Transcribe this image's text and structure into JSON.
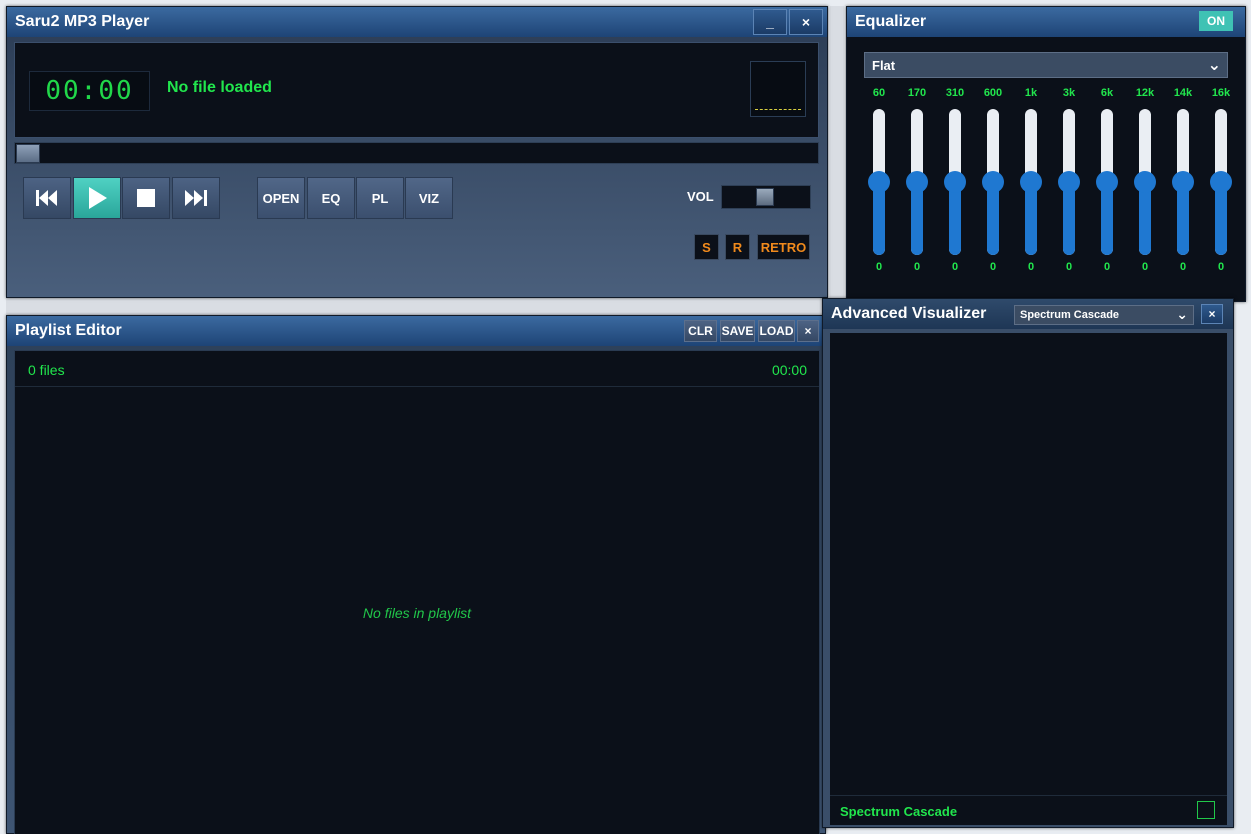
{
  "player": {
    "title": "Saru2 MP3 Player",
    "minimize_label": "_",
    "close_label": "×",
    "time": "00:00",
    "status": "No file loaded",
    "buttons": {
      "open": "OPEN",
      "eq": "EQ",
      "pl": "PL",
      "viz": "VIZ"
    },
    "volume_label": "VOL",
    "volume_level": 0.45,
    "options": {
      "shuffle": "S",
      "repeat": "R",
      "retro": "RETRO"
    }
  },
  "equalizer": {
    "title": "Equalizer",
    "toggle": "ON",
    "preset": "Flat",
    "bands": [
      {
        "freq": "60",
        "value": "0"
      },
      {
        "freq": "170",
        "value": "0"
      },
      {
        "freq": "310",
        "value": "0"
      },
      {
        "freq": "600",
        "value": "0"
      },
      {
        "freq": "1k",
        "value": "0"
      },
      {
        "freq": "3k",
        "value": "0"
      },
      {
        "freq": "6k",
        "value": "0"
      },
      {
        "freq": "12k",
        "value": "0"
      },
      {
        "freq": "14k",
        "value": "0"
      },
      {
        "freq": "16k",
        "value": "0"
      }
    ]
  },
  "playlist": {
    "title": "Playlist Editor",
    "buttons": {
      "clear": "CLR",
      "save": "SAVE",
      "load": "LOAD",
      "close": "×"
    },
    "file_count": "0 files",
    "total_time": "00:00",
    "empty_message": "No files in playlist"
  },
  "visualizer": {
    "title": "Advanced Visualizer",
    "mode": "Spectrum Cascade",
    "close_label": "×",
    "footer_label": "Spectrum Cascade"
  },
  "colors": {
    "accent_green": "#21e64d",
    "accent_teal": "#3fc2b4",
    "slider_blue": "#1f78d1",
    "orange": "#f08a1c"
  }
}
